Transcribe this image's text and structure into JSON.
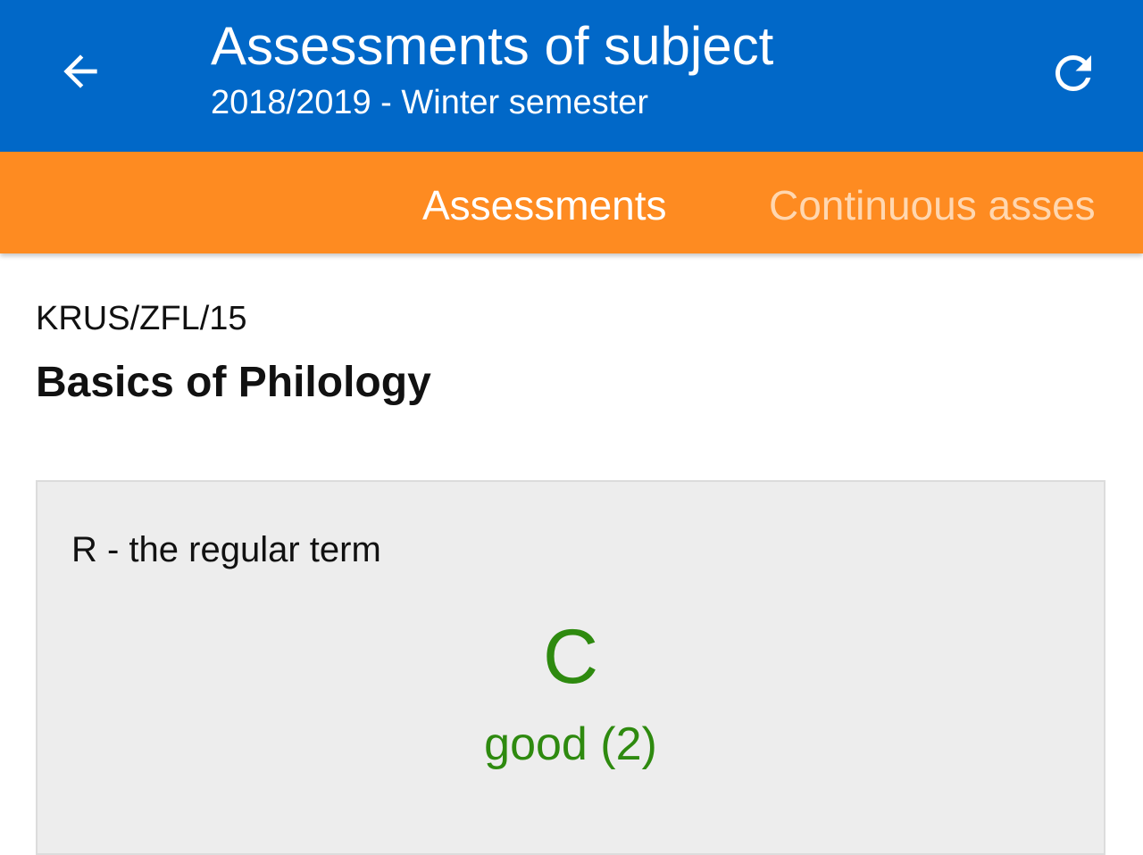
{
  "header": {
    "title": "Assessments of subject",
    "subtitle": "2018/2019 - Winter semester",
    "back_icon": "arrow-left-icon",
    "refresh_icon": "refresh-icon",
    "background_color": "#0168c8"
  },
  "tabs": {
    "background_color": "#fe8b21",
    "items": [
      {
        "label": "Assessments",
        "active": true
      },
      {
        "label": "Continuous asses",
        "active": false
      }
    ]
  },
  "subject": {
    "code": "KRUS/ZFL/15",
    "name": "Basics of Philology"
  },
  "assessment": {
    "term": "R - the regular term",
    "grade": "C",
    "grade_description": "good (2)",
    "grade_color": "#2e8a0f"
  }
}
